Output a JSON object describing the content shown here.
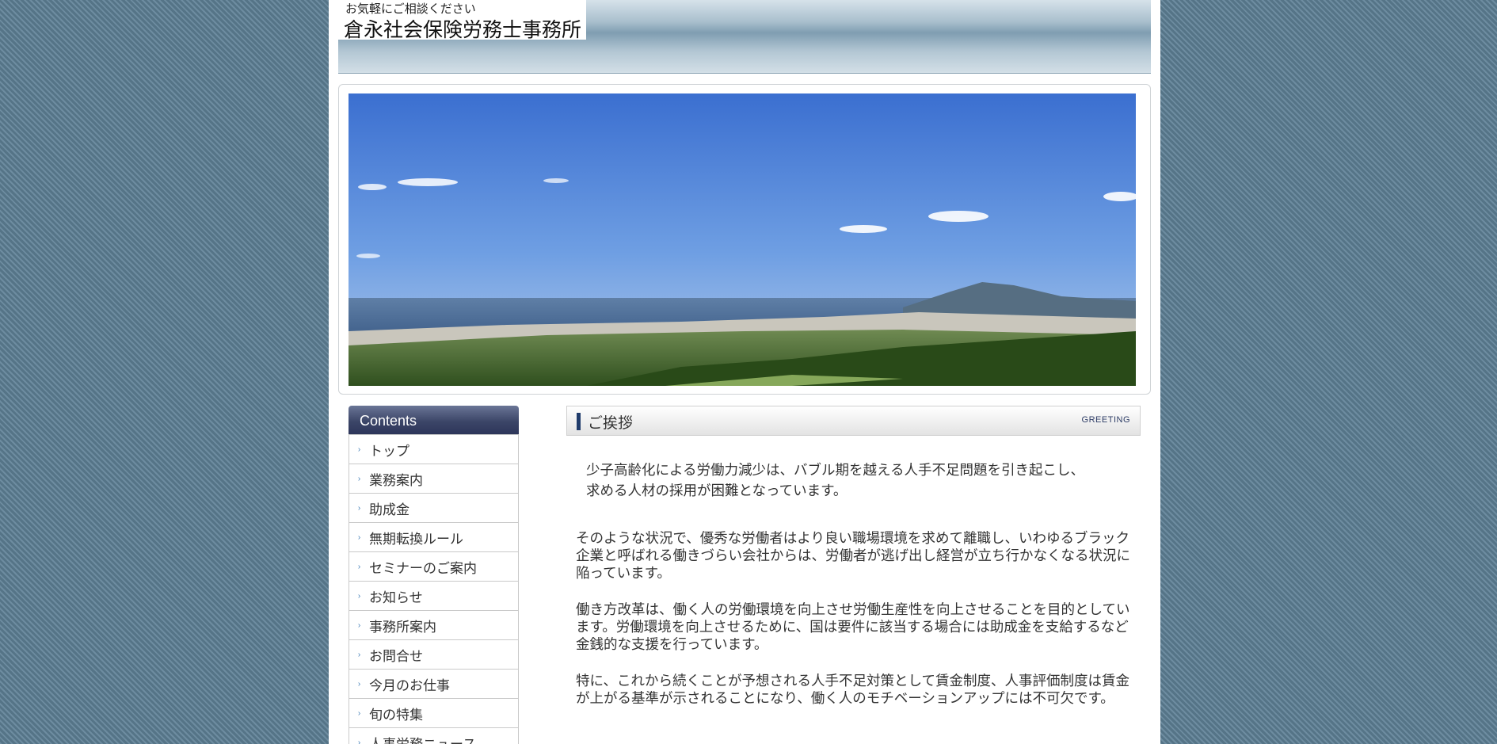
{
  "header": {
    "tagline": "お気軽にご相談ください",
    "site_title": "倉永社会保険労務士事務所"
  },
  "sidebar": {
    "title": "Contents",
    "items": [
      {
        "label": "トップ"
      },
      {
        "label": "業務案内"
      },
      {
        "label": "助成金"
      },
      {
        "label": "無期転換ルール"
      },
      {
        "label": "セミナーのご案内"
      },
      {
        "label": "お知らせ"
      },
      {
        "label": "事務所案内"
      },
      {
        "label": "お問合せ"
      },
      {
        "label": "今月のお仕事"
      },
      {
        "label": "旬の特集"
      },
      {
        "label": "人事労務ニュース"
      }
    ]
  },
  "greeting": {
    "title": "ご挨拶",
    "en_label": "GREETING",
    "paragraphs": [
      "少子高齢化による労働力減少は、バブル期を越える人手不足問題を引き起こし、求める人材の採用が困難となっています。",
      "そのような状況で、優秀な労働者はより良い職場環境を求めて離職し、いわゆるブラック企業と呼ばれる働きづらい会社からは、労働者が逃げ出し経営が立ち行かなくなる状況に陥っています。",
      "働き方改革は、働く人の労働環境を向上させ労働生産性を向上させることを目的としています。労働環境を向上させるために、国は要件に該当する場合には助成金を支給するなど金銭的な支援を行っています。",
      "特に、これから続くことが予想される人手不足対策として賃金制度、人事評価制度は賃金が上がる基準が示されることになり、働く人のモチベーションアップには不可欠です。"
    ]
  },
  "colors": {
    "background": "#5f7f93",
    "accent": "#1f3b6b",
    "nav_header": "#3c4668",
    "nav_arrow": "#3e7bb5"
  }
}
